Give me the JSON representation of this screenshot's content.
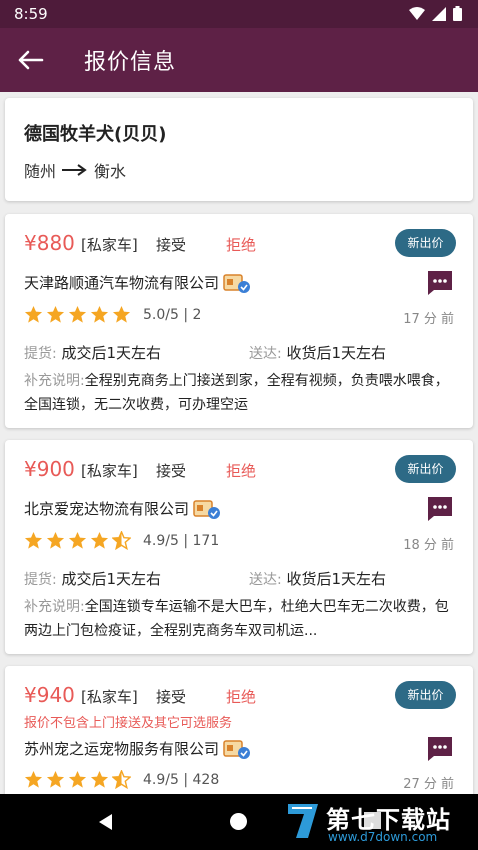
{
  "statusbar": {
    "time": "8:59"
  },
  "appbar": {
    "title": "报价信息"
  },
  "pet": {
    "name": "德国牧羊犬(贝贝)",
    "from": "随州",
    "to": "衡水"
  },
  "quotes": [
    {
      "price": "¥880",
      "car_type": "[私家车]",
      "accept": "接受",
      "reject": "拒绝",
      "new_bid": "新出价",
      "company": "天津路顺通汽车物流有限公司",
      "rating": 5.0,
      "score": "5.0/5 | 2",
      "time_ago": "17 分 前",
      "pickup_label": "提货:",
      "pickup": "成交后1天左右",
      "delivery_label": "送达:",
      "delivery": "收货后1天左右",
      "remark_label": "补充说明:",
      "remark": "全程别克商务上门接送到家，全程有视频，负责喂水喂食，全国连锁，无二次收费，可办理空运"
    },
    {
      "price": "¥900",
      "car_type": "[私家车]",
      "accept": "接受",
      "reject": "拒绝",
      "new_bid": "新出价",
      "company": "北京爱宠达物流有限公司",
      "rating": 4.5,
      "score": "4.9/5 | 171",
      "time_ago": "18 分 前",
      "pickup_label": "提货:",
      "pickup": "成交后1天左右",
      "delivery_label": "送达:",
      "delivery": "收货后1天左右",
      "remark_label": "补充说明:",
      "remark": "全国连锁专车运输不是大巴车，杜绝大巴车无二次收费，包两边上门包检疫证，全程别克商务车双司机运..."
    },
    {
      "price": "¥940",
      "car_type": "[私家车]",
      "accept": "接受",
      "reject": "拒绝",
      "new_bid": "新出价",
      "note": "报价不包含上门接送及其它可选服务",
      "company": "苏州宠之运宠物服务有限公司",
      "rating": 4.5,
      "score": "4.9/5 | 428",
      "time_ago": "27 分 前"
    }
  ],
  "watermark": {
    "title": "第七下载站",
    "url": "www.d7down.com"
  },
  "colors": {
    "primary": "#5e2146",
    "statusbar": "#4e1b3a",
    "accent": "#e85a57",
    "new_bid": "#2d6a86",
    "star": "#f5a623"
  }
}
